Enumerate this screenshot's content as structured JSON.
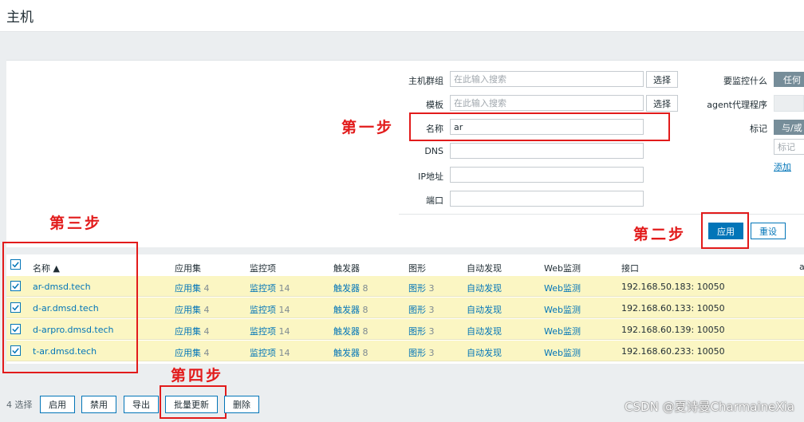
{
  "page": {
    "title": "主机"
  },
  "filter": {
    "host_group": {
      "label": "主机群组",
      "placeholder": "在此输入搜索",
      "select": "选择"
    },
    "template": {
      "label": "模板",
      "placeholder": "在此输入搜索",
      "select": "选择"
    },
    "name": {
      "label": "名称",
      "value": "ar"
    },
    "dns": {
      "label": "DNS",
      "value": ""
    },
    "ip": {
      "label": "IP地址",
      "value": ""
    },
    "port": {
      "label": "端口",
      "value": ""
    },
    "monitor_what": {
      "label": "要监控什么",
      "value": "任何"
    },
    "agent_proxy": {
      "label": "agent代理程序"
    },
    "tags": {
      "label": "标记",
      "mode": "与/或",
      "placeholder": "标记",
      "add": "添加"
    },
    "apply": "应用",
    "reset": "重设"
  },
  "annotations": {
    "step1": "第一步",
    "step2": "第二步",
    "step3": "第三步",
    "step4": "第四步"
  },
  "table": {
    "columns": [
      "名称 ▲",
      "应用集",
      "监控项",
      "触发器",
      "图形",
      "自动发现",
      "Web监测",
      "接口",
      "a"
    ],
    "rows": [
      {
        "name": "ar-dmsd.tech",
        "apps": "应用集",
        "apps_n": "4",
        "items": "监控项",
        "items_n": "14",
        "triggers": "触发器",
        "triggers_n": "8",
        "graphs": "图形",
        "graphs_n": "3",
        "discovery": "自动发现",
        "web": "Web监测",
        "interface": "192.168.50.183: 10050"
      },
      {
        "name": "d-ar.dmsd.tech",
        "apps": "应用集",
        "apps_n": "4",
        "items": "监控项",
        "items_n": "14",
        "triggers": "触发器",
        "triggers_n": "8",
        "graphs": "图形",
        "graphs_n": "3",
        "discovery": "自动发现",
        "web": "Web监测",
        "interface": "192.168.60.133: 10050"
      },
      {
        "name": "d-arpro.dmsd.tech",
        "apps": "应用集",
        "apps_n": "4",
        "items": "监控项",
        "items_n": "14",
        "triggers": "触发器",
        "triggers_n": "8",
        "graphs": "图形",
        "graphs_n": "3",
        "discovery": "自动发现",
        "web": "Web监测",
        "interface": "192.168.60.139: 10050"
      },
      {
        "name": "t-ar.dmsd.tech",
        "apps": "应用集",
        "apps_n": "4",
        "items": "监控项",
        "items_n": "14",
        "triggers": "触发器",
        "triggers_n": "8",
        "graphs": "图形",
        "graphs_n": "3",
        "discovery": "自动发现",
        "web": "Web监测",
        "interface": "192.168.60.233: 10050"
      }
    ]
  },
  "footer": {
    "selected": "4 选择",
    "enable": "启用",
    "disable": "禁用",
    "export": "导出",
    "mass_update": "批量更新",
    "delete": "删除"
  },
  "watermark": "CSDN @夏诗曼CharmaineXia",
  "colors": {
    "accent": "#0275b8",
    "highlight_row": "#fbf6c3",
    "annotation": "#e21b1b"
  }
}
